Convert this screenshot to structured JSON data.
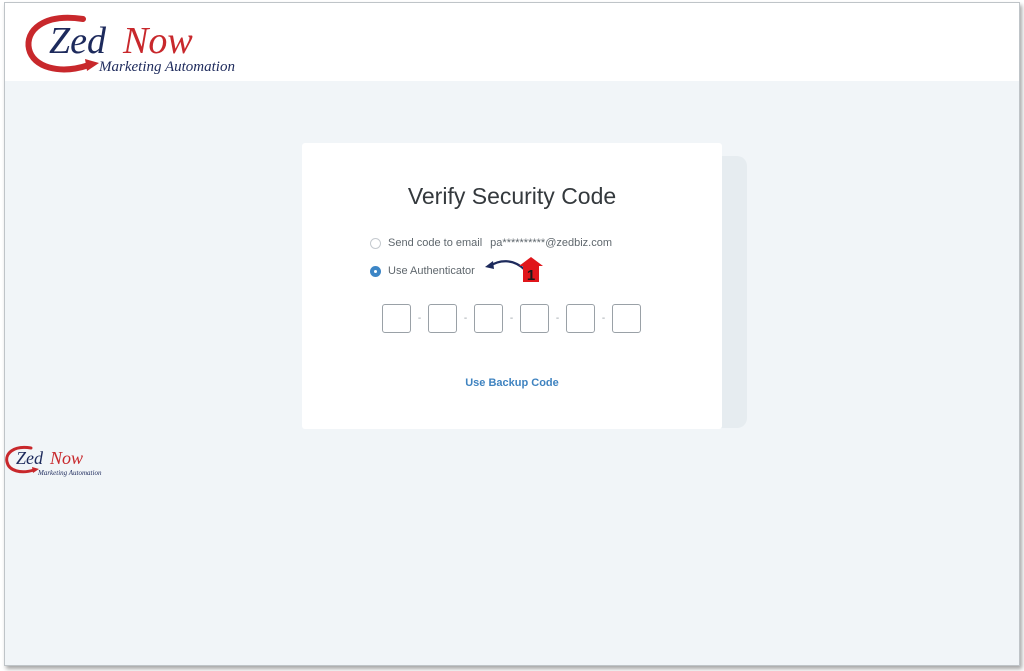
{
  "brand": {
    "name_part1": "Zed",
    "name_part2": "Now",
    "tagline": "Marketing Automation"
  },
  "colors": {
    "brand_red": "#c8282c",
    "brand_navy": "#1d2a5c",
    "link_blue": "#3f83c0",
    "radio_blue": "#3d86c6",
    "annotation_red": "#e0161b"
  },
  "verify": {
    "title": "Verify Security Code",
    "options": [
      {
        "label": "Send code to email",
        "email": "pa**********@zedbiz.com",
        "selected": false
      },
      {
        "label": "Use Authenticator",
        "selected": true
      }
    ],
    "code_boxes": 6,
    "backup_link": "Use Backup Code"
  },
  "annotation": {
    "step": "1",
    "icon": "curved-arrow-left-icon"
  }
}
